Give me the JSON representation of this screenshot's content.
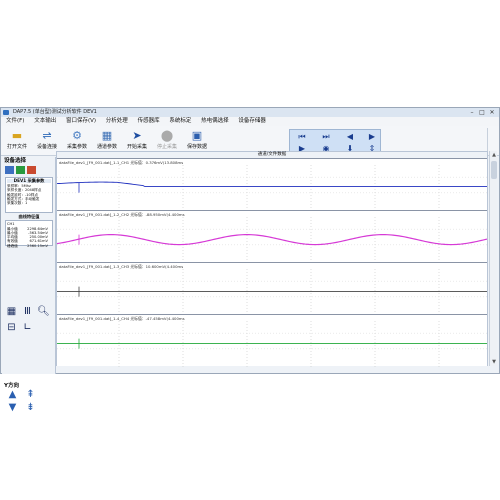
{
  "window": {
    "title": "DAP7.5 (单台型)测试分析软件 DEV1",
    "controls": [
      "–",
      "□",
      "✕"
    ]
  },
  "menu": [
    "文件(F)",
    "文本输出",
    "窗口保存(V)",
    "分析处理",
    "传感器库",
    "系统标定",
    "热电偶选择",
    "设备存储器"
  ],
  "toolbar": {
    "open_file": "打开文件",
    "connect": "设备连接",
    "acq_params": "采集参数",
    "channel_params": "通道参数",
    "start_acq": "开始采集",
    "stop_acq": "停止采集",
    "save_data": "保存数据"
  },
  "left": {
    "device_select": "设备选择",
    "device_box": {
      "title": "DEV1 采集参数",
      "lines": [
        "采样率：5Mhz",
        "采样长度：2048样点",
        "触发延时：-10样点",
        "触发方式：手动触发",
        "采集次数：1"
      ]
    },
    "cursor_box": {
      "title": "曲线特征值",
      "channel": "CH1",
      "rows": [
        {
          "label": "最小值",
          "value": "2298.64mV"
        },
        {
          "label": "最小值",
          "value": "-563.54mV"
        },
        {
          "label": "平均值",
          "value": "250.00mV"
        },
        {
          "label": "有效值",
          "value": "671.61mV"
        },
        {
          "label": "峰峰值",
          "value": "2560.15mV"
        },
        {
          "label": "频　率",
          "value": "926.03kHz"
        }
      ]
    },
    "y_direction": "Y方向"
  },
  "main": {
    "title": "通道/文件数据",
    "channels": [
      {
        "label": "dataFile_dev1_[F9_001.dat]_1-1_CH1   光标值：0.376mV(13.808ms",
        "color": "#1f2fbf"
      },
      {
        "label": "dataFile_dev1_[F9_001.dat]_1-2_CH2   光标值：-88.950mV(4.400ms",
        "color": "#d63ad6"
      },
      {
        "label": "dataFile_dev1_[F9_001.dat]_1-3_CH3   光标值：10.600mV(4.400ms",
        "color": "#444444"
      },
      {
        "label": "dataFile_dev1_[F9_001.dat]_1-4_CH4   光标值：-47.458mV(4.400ms",
        "color": "#21a838"
      }
    ]
  }
}
